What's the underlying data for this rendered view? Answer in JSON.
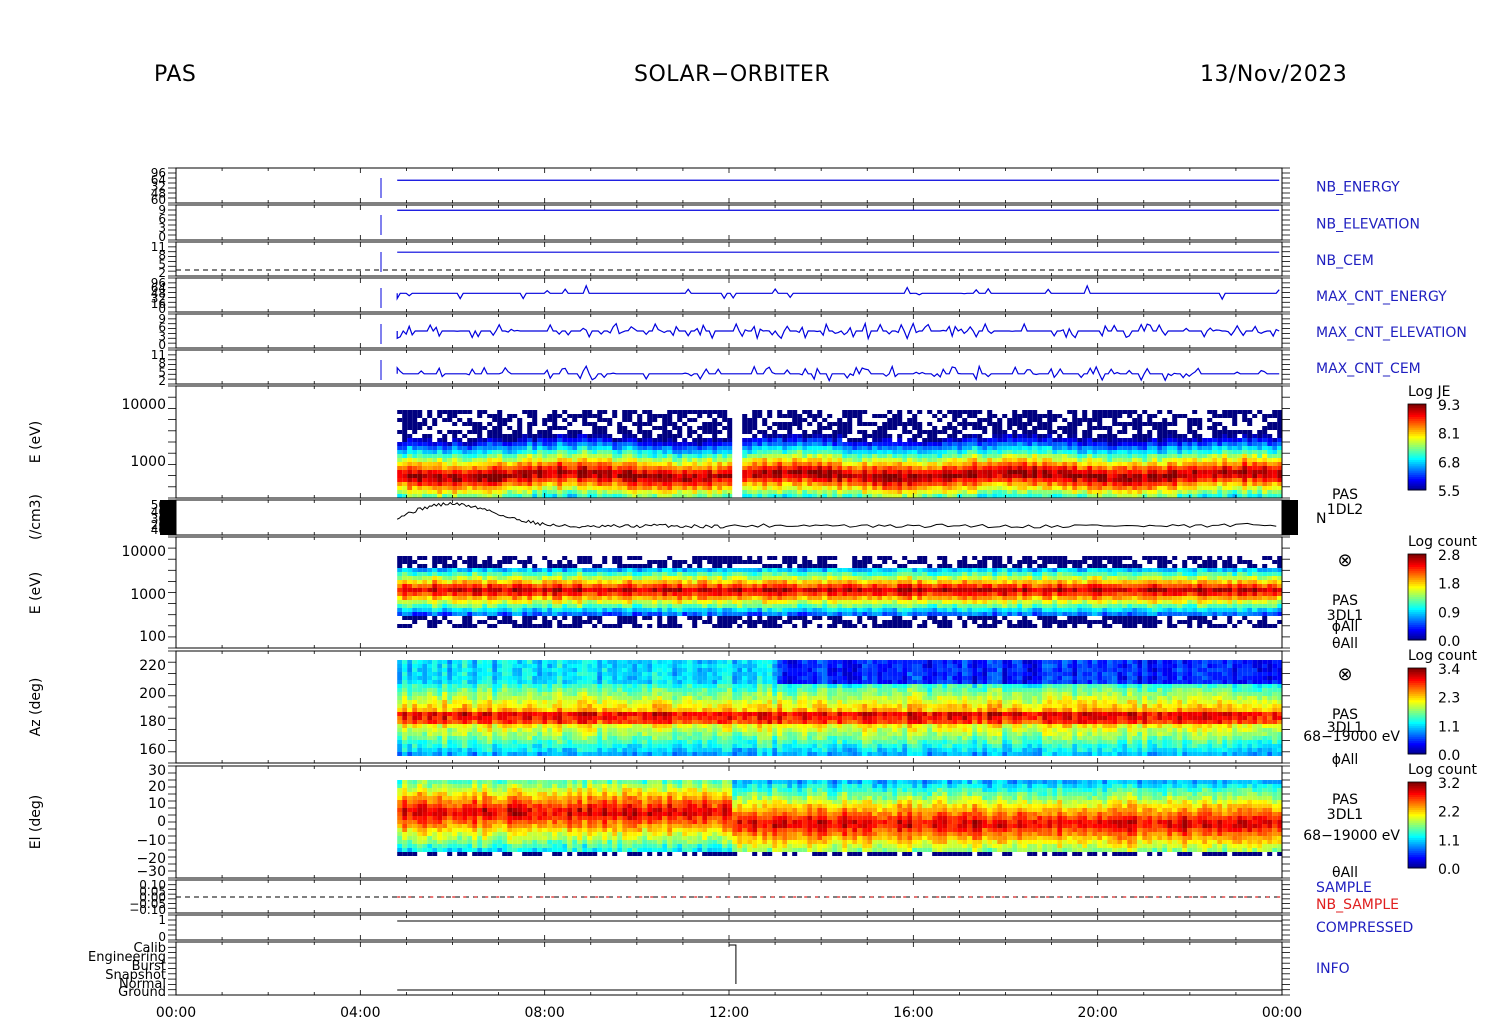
{
  "header": {
    "left": "PAS",
    "center": "SOLAR−ORBITER",
    "right": "13/Nov/2023"
  },
  "colors": {
    "hk_label": "#2020c0",
    "nb_sample_label": "#e02020",
    "trace_blue": "#0000dd",
    "trace_black": "#000000"
  },
  "chart_data": {
    "type": "heatmap",
    "x_axis": {
      "ticks": [
        "00:00",
        "04:00",
        "08:00",
        "12:00",
        "16:00",
        "20:00",
        "00:00"
      ],
      "range_hours": [
        0,
        24
      ]
    },
    "data_start_hour": 4.8,
    "panels": [
      {
        "id": "nb_energy",
        "label": "NB_ENERGY",
        "label_color": "blue",
        "y_ticks": [
          "96",
          "64",
          "32",
          "48",
          "60"
        ]
      },
      {
        "id": "nb_elevation",
        "label": "NB_ELEVATION",
        "label_color": "blue",
        "y_ticks": [
          "9",
          "6",
          "3",
          "0"
        ]
      },
      {
        "id": "nb_cem",
        "label": "NB_CEM",
        "label_color": "blue",
        "y_ticks": [
          "11",
          "8",
          "5",
          "2"
        ]
      },
      {
        "id": "max_cnt_energy",
        "label": "MAX_CNT_ENERGY",
        "label_color": "blue",
        "y_ticks": [
          "96",
          "64",
          "48",
          "32",
          "16",
          "0"
        ]
      },
      {
        "id": "max_cnt_elevation",
        "label": "MAX_CNT_ELEVATION",
        "label_color": "blue",
        "y_ticks": [
          "9",
          "6",
          "3",
          "0"
        ]
      },
      {
        "id": "max_cnt_cem",
        "label": "MAX_CNT_CEM",
        "label_color": "blue",
        "y_ticks": [
          "11",
          "8",
          "5",
          "2"
        ]
      },
      {
        "id": "energy_je",
        "ylabel": "E (eV)",
        "y_ticks": [
          "10000",
          "1000"
        ],
        "yscale": "log",
        "colorbar": {
          "title": "Log JE",
          "ticks": [
            "9.3",
            "8.1",
            "6.8",
            "5.5"
          ]
        },
        "gap_hour": 12.1
      },
      {
        "id": "density",
        "ylabel": "(/cm3)",
        "y_ticks": [
          "50",
          "40",
          "30",
          "20",
          "40"
        ],
        "side_label_1": "PAS",
        "side_label_2": "1DL2",
        "side_label_3": "N",
        "trace": [
          {
            "t": 4.8,
            "n": 30
          },
          {
            "t": 5.2,
            "n": 38
          },
          {
            "t": 5.6,
            "n": 44
          },
          {
            "t": 6.0,
            "n": 46
          },
          {
            "t": 6.4,
            "n": 43
          },
          {
            "t": 6.8,
            "n": 38
          },
          {
            "t": 7.2,
            "n": 30
          },
          {
            "t": 7.6,
            "n": 26
          },
          {
            "t": 8.0,
            "n": 22
          },
          {
            "t": 8.5,
            "n": 20
          },
          {
            "t": 9.0,
            "n": 19
          },
          {
            "t": 9.5,
            "n": 20
          },
          {
            "t": 10.0,
            "n": 20
          },
          {
            "t": 10.5,
            "n": 21
          },
          {
            "t": 11.0,
            "n": 20
          },
          {
            "t": 11.5,
            "n": 20
          },
          {
            "t": 12.0,
            "n": 20
          },
          {
            "t": 13.0,
            "n": 21
          },
          {
            "t": 14.0,
            "n": 21
          },
          {
            "t": 15.0,
            "n": 20
          },
          {
            "t": 16.0,
            "n": 20
          },
          {
            "t": 17.0,
            "n": 21
          },
          {
            "t": 18.0,
            "n": 20
          },
          {
            "t": 19.0,
            "n": 20
          },
          {
            "t": 20.0,
            "n": 21
          },
          {
            "t": 21.0,
            "n": 20
          },
          {
            "t": 22.0,
            "n": 20
          },
          {
            "t": 23.0,
            "n": 21
          },
          {
            "t": 24.0,
            "n": 22
          }
        ]
      },
      {
        "id": "energy_3d",
        "ylabel": "E (eV)",
        "y_ticks": [
          "10000",
          "1000",
          "100"
        ],
        "yscale": "log",
        "colorbar": {
          "title": "Log count",
          "ticks": [
            "2.8",
            "1.8",
            "0.9",
            "0.0"
          ]
        },
        "side_labels": [
          "⊗",
          "PAS",
          "3DL1",
          "ϕAll",
          "θAll"
        ]
      },
      {
        "id": "azimuth",
        "ylabel": "Az (deg)",
        "y_ticks": [
          "220",
          "200",
          "180",
          "160"
        ],
        "colorbar": {
          "title": "Log count",
          "ticks": [
            "3.4",
            "2.3",
            "1.1",
            "0.0"
          ]
        },
        "side_labels": [
          "⊗",
          "PAS",
          "3DL1",
          "68−19000 eV",
          "ϕAll"
        ]
      },
      {
        "id": "elevation",
        "ylabel": "El (deg)",
        "y_ticks": [
          "30",
          "20",
          "10",
          "0",
          "−10",
          "−20",
          "−30"
        ],
        "colorbar": {
          "title": "Log count",
          "ticks": [
            "3.2",
            "2.2",
            "1.1",
            "0.0"
          ]
        },
        "side_labels": [
          "PAS",
          "3DL1",
          "68−19000 eV",
          "θAll"
        ]
      },
      {
        "id": "sample",
        "labels": [
          "SAMPLE",
          "NB_SAMPLE"
        ],
        "label_colors": [
          "blue",
          "red"
        ],
        "y_ticks": [
          "0.10",
          "0.05",
          "0.00",
          "−0.05",
          "−0.10"
        ]
      },
      {
        "id": "compressed",
        "label": "COMPRESSED",
        "label_color": "blue",
        "y_ticks": [
          "1",
          "0"
        ]
      },
      {
        "id": "info",
        "label": "INFO",
        "label_color": "blue",
        "y_ticks": [
          "Calib",
          "Engineering",
          "Burst",
          "Snapshot",
          "Normal",
          "Ground"
        ]
      }
    ]
  }
}
